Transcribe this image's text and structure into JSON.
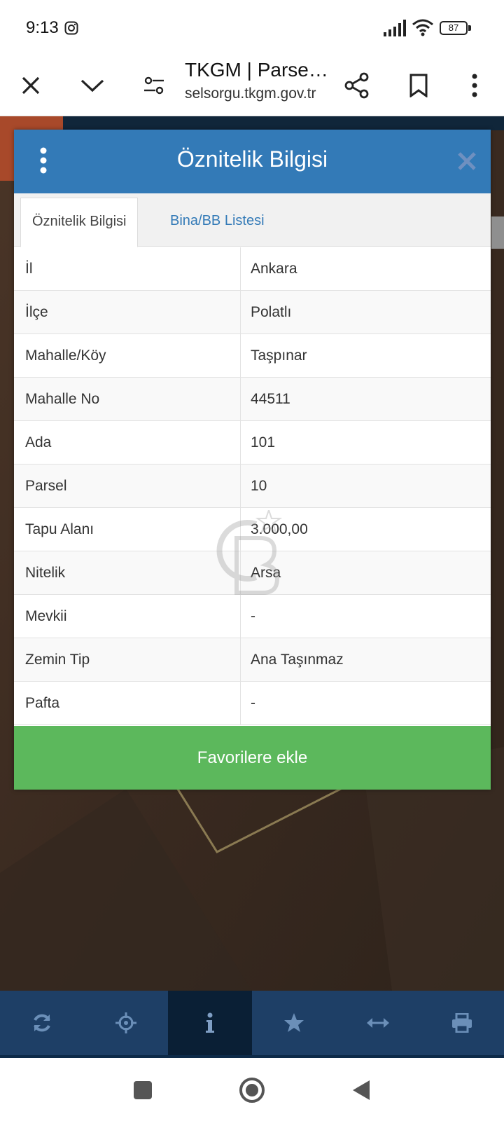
{
  "status_bar": {
    "time": "9:13",
    "battery": "87"
  },
  "browser": {
    "title": "TKGM | Parse…",
    "url": "selsorgu.tkgm.gov.tr"
  },
  "modal": {
    "title": "Öznitelik Bilgisi",
    "tabs": [
      {
        "label": "Öznitelik Bilgisi",
        "active": true
      },
      {
        "label": "Bina/BB Listesi",
        "active": false
      }
    ],
    "rows": [
      {
        "key": "İl",
        "value": "Ankara"
      },
      {
        "key": "İlçe",
        "value": "Polatlı"
      },
      {
        "key": "Mahalle/Köy",
        "value": "Taşpınar"
      },
      {
        "key": "Mahalle No",
        "value": "44511"
      },
      {
        "key": "Ada",
        "value": "101"
      },
      {
        "key": "Parsel",
        "value": "10"
      },
      {
        "key": "Tapu Alanı",
        "value": "3.000,00"
      },
      {
        "key": "Nitelik",
        "value": "Arsa"
      },
      {
        "key": "Mevkii",
        "value": "-"
      },
      {
        "key": "Zemin Tip",
        "value": "Ana Taşınmaz"
      },
      {
        "key": "Pafta",
        "value": "-"
      }
    ],
    "button_label": "Favorilere ekle"
  },
  "map_toolbar": {
    "icons": [
      "refresh-icon",
      "locate-icon",
      "info-icon",
      "star-icon",
      "measure-icon",
      "print-icon"
    ],
    "active": "info-icon"
  },
  "colors": {
    "header_blue": "#337ab7",
    "button_green": "#5cb85c",
    "toolbar_blue": "#1e3f66"
  }
}
